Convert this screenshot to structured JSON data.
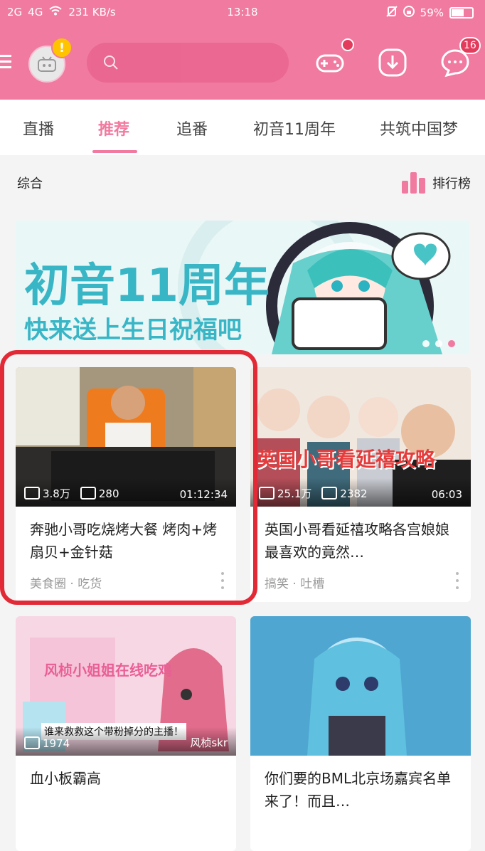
{
  "status_bar": {
    "network_left": "2G",
    "network_right": "4G",
    "speed": "231 KB/s",
    "time": "13:18",
    "battery": "59%"
  },
  "app": {
    "tabs": [
      {
        "label": "直播"
      },
      {
        "label": "推荐"
      },
      {
        "label": "追番"
      },
      {
        "label": "初音11周年"
      },
      {
        "label": "共筑中国梦"
      }
    ],
    "message_badge": "16",
    "notification_badge": "!"
  },
  "section": {
    "title": "综合",
    "rank_label": "排行榜"
  },
  "banner": {
    "title": "初音11周年",
    "subtitle": "快来送上生日祝福吧"
  },
  "cards": [
    {
      "title": "奔驰小哥吃烧烤大餐 烤肉+烤扇贝+金针菇",
      "meta": "美食圈 · 吃货",
      "views": "3.8万",
      "danmaku": "280",
      "duration": "01:12:34"
    },
    {
      "title": "英国小哥看延禧攻略各宫娘娘 最喜欢的竟然…",
      "meta": "搞笑 · 吐槽",
      "views": "25.1万",
      "danmaku": "2382",
      "duration": "06:03",
      "thumb_caption": "英国小哥看延禧攻略"
    },
    {
      "title": "血小板霸高",
      "meta": "",
      "views": "1974",
      "danmaku": "",
      "duration": "",
      "thumb_caption": "风桢小姐姐在线吃鸡",
      "thumb_caption2": "谁来救救这个带粉掉分的主播！",
      "thumb_watermark": "风桢skr"
    },
    {
      "title": "你们要的BML北京场嘉宾名单来了！而且…",
      "meta": "",
      "views": "",
      "danmaku": "",
      "duration": ""
    }
  ],
  "colors": {
    "brand_pink": "#f17aa0",
    "annotation_red": "#e22a36"
  }
}
